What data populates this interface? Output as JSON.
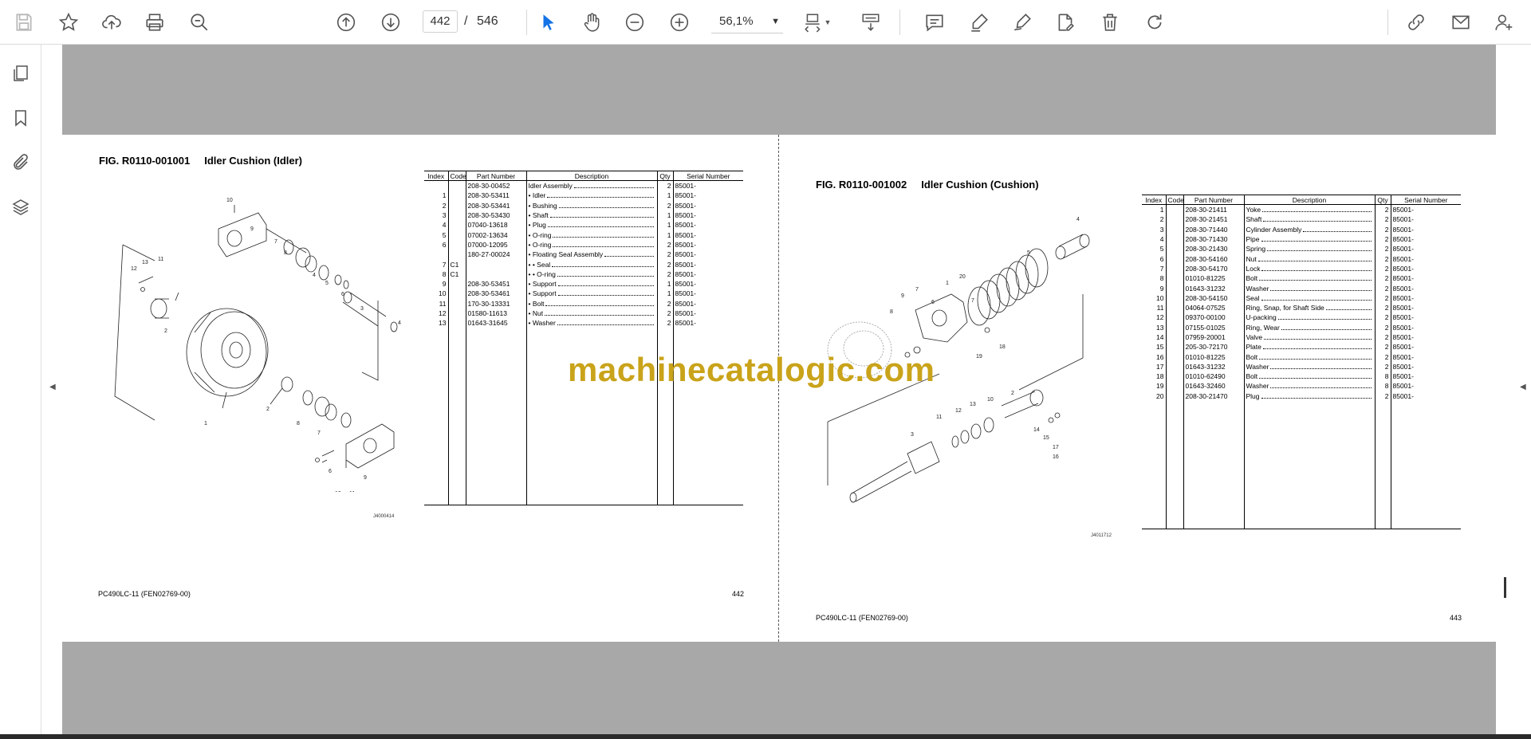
{
  "toolbar": {
    "left_icons": [
      "save-icon",
      "star-icon",
      "upload-icon",
      "print-icon",
      "zoom-search-icon"
    ],
    "page_current": "442",
    "page_separator": "/",
    "page_total": "546",
    "zoom": "56,1%",
    "accent_color": "#1473e6"
  },
  "sidebar": {
    "items": [
      "pages-icon",
      "bookmark-icon",
      "attachment-icon",
      "layers-icon"
    ]
  },
  "watermark": "machinecatalogic.com",
  "left_page": {
    "fig_code": "FIG. R0110-001001",
    "fig_name": "Idler Cushion (Idler)",
    "headers": [
      "Index",
      "Code",
      "Part Number",
      "Description",
      "Qty",
      "Serial Number"
    ],
    "rows": [
      [
        "",
        "",
        "208-30-00452",
        "Idler Assembly",
        "2",
        "85001-"
      ],
      [
        "1",
        "",
        "208-30-53411",
        "• Idler",
        "1",
        "85001-"
      ],
      [
        "2",
        "",
        "208-30-53441",
        "• Bushing",
        "2",
        "85001-"
      ],
      [
        "3",
        "",
        "208-30-53430",
        "• Shaft",
        "1",
        "85001-"
      ],
      [
        "4",
        "",
        "07040-13618",
        "• Plug",
        "1",
        "85001-"
      ],
      [
        "5",
        "",
        "07002-13634",
        "• O-ring",
        "1",
        "85001-"
      ],
      [
        "6",
        "",
        "07000-12095",
        "• O-ring",
        "2",
        "85001-"
      ],
      [
        "",
        "",
        "180-27-00024",
        "• Floating Seal Assembly",
        "2",
        "85001-"
      ],
      [
        "7",
        "C1",
        "",
        "• • Seal",
        "2",
        "85001-"
      ],
      [
        "8",
        "C1",
        "",
        "• • O-ring",
        "2",
        "85001-"
      ],
      [
        "9",
        "",
        "208-30-53451",
        "• Support",
        "1",
        "85001-"
      ],
      [
        "10",
        "",
        "208-30-53461",
        "• Support",
        "1",
        "85001-"
      ],
      [
        "11",
        "",
        "170-30-13331",
        "• Bolt",
        "2",
        "85001-"
      ],
      [
        "12",
        "",
        "01580-11613",
        "• Nut",
        "2",
        "85001-"
      ],
      [
        "13",
        "",
        "01643-31645",
        "• Washer",
        "2",
        "85001-"
      ]
    ],
    "footer_model": "PC490LC-11 (FEN02769-00)",
    "page_number": "442",
    "drawing_code": "J4000414"
  },
  "right_page": {
    "fig_code": "FIG. R0110-001002",
    "fig_name": "Idler Cushion (Cushion)",
    "headers": [
      "Index",
      "Code",
      "Part Number",
      "Description",
      "Qty",
      "Serial Number"
    ],
    "rows": [
      [
        "1",
        "",
        "208-30-21411",
        "Yoke",
        "2",
        "85001-"
      ],
      [
        "2",
        "",
        "208-30-21451",
        "Shaft",
        "2",
        "85001-"
      ],
      [
        "3",
        "",
        "208-30-71440",
        "Cylinder Assembly",
        "2",
        "85001-"
      ],
      [
        "4",
        "",
        "208-30-71430",
        "Pipe",
        "2",
        "85001-"
      ],
      [
        "5",
        "",
        "208-30-21430",
        "Spring",
        "2",
        "85001-"
      ],
      [
        "6",
        "",
        "208-30-54160",
        "Nut",
        "2",
        "85001-"
      ],
      [
        "7",
        "",
        "208-30-54170",
        "Lock",
        "2",
        "85001-"
      ],
      [
        "8",
        "",
        "01010-81225",
        "Bolt",
        "2",
        "85001-"
      ],
      [
        "9",
        "",
        "01643-31232",
        "Washer",
        "2",
        "85001-"
      ],
      [
        "10",
        "",
        "208-30-54150",
        "Seal",
        "2",
        "85001-"
      ],
      [
        "11",
        "",
        "04064-07525",
        "Ring, Snap, for Shaft Side",
        "2",
        "85001-"
      ],
      [
        "12",
        "",
        "09370-00100",
        "U-packing",
        "2",
        "85001-"
      ],
      [
        "13",
        "",
        "07155-01025",
        "Ring, Wear",
        "2",
        "85001-"
      ],
      [
        "14",
        "",
        "07959-20001",
        "Valve",
        "2",
        "85001-"
      ],
      [
        "15",
        "",
        "205-30-72170",
        "Plate",
        "2",
        "85001-"
      ],
      [
        "16",
        "",
        "01010-81225",
        "Bolt",
        "2",
        "85001-"
      ],
      [
        "17",
        "",
        "01643-31232",
        "Washer",
        "2",
        "85001-"
      ],
      [
        "18",
        "",
        "01010-62490",
        "Bolt",
        "8",
        "85001-"
      ],
      [
        "19",
        "",
        "01643-32460",
        "Washer",
        "8",
        "85001-"
      ],
      [
        "20",
        "",
        "208-30-21470",
        "Plug",
        "2",
        "85001-"
      ]
    ],
    "footer_model": "PC490LC-11 (FEN02769-00)",
    "page_number": "443",
    "drawing_code": "J4011712"
  }
}
